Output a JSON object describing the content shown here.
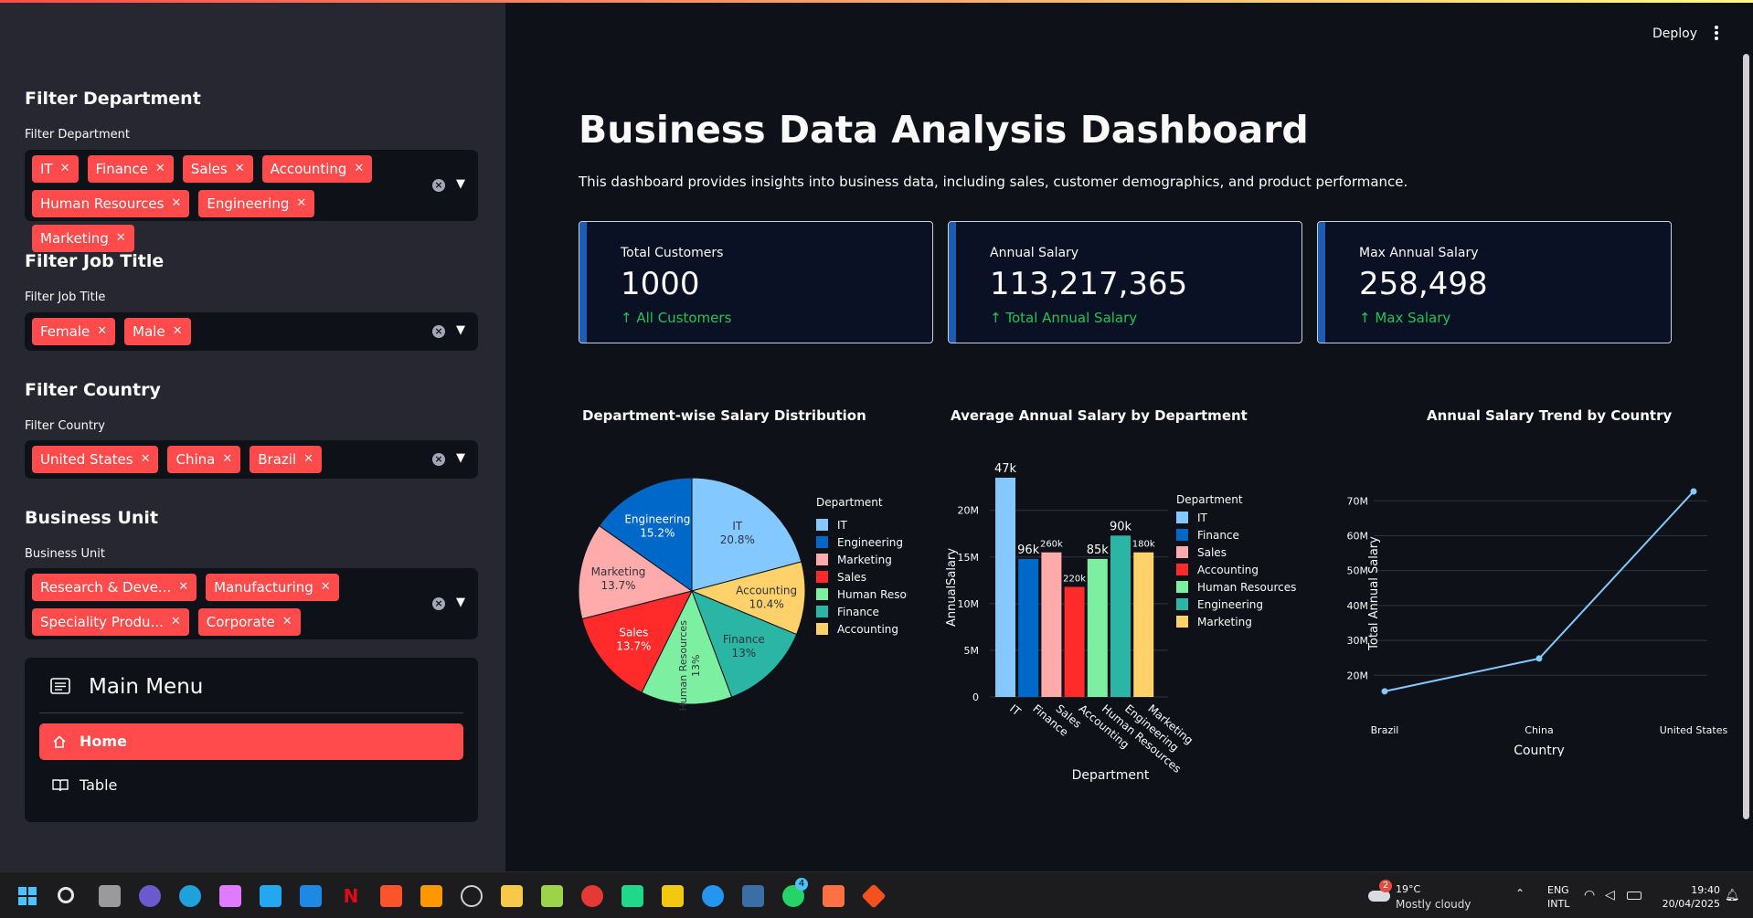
{
  "header": {
    "deploy_label": "Deploy",
    "more_icon": "vertical-ellipsis-icon"
  },
  "sidebar": {
    "department": {
      "heading": "Filter Department",
      "label": "Filter Department",
      "tags": [
        "IT",
        "Finance",
        "Sales",
        "Accounting",
        "Human Resources",
        "Engineering",
        "Marketing"
      ]
    },
    "job_title": {
      "heading": "Filter Job Title",
      "label": "Filter Job Title",
      "tags": [
        "Female",
        "Male"
      ]
    },
    "country": {
      "heading": "Filter Country",
      "label": "Filter Country",
      "tags": [
        "United States",
        "China",
        "Brazil"
      ]
    },
    "business_unit": {
      "heading": "Business Unit",
      "label": "Business Unit",
      "tags": [
        "Research & Deve...",
        "Manufacturing",
        "Speciality Produ...",
        "Corporate"
      ]
    },
    "menu": {
      "title": "Main Menu",
      "items": [
        {
          "label": "Home",
          "icon": "house-icon",
          "active": true
        },
        {
          "label": "Table",
          "icon": "book-icon",
          "active": false
        }
      ]
    }
  },
  "main": {
    "title": "Business Data Analysis Dashboard",
    "description": "This dashboard provides insights into business data, including sales, customer demographics, and product performance.",
    "kpis": [
      {
        "label": "Total Customers",
        "value": "1000",
        "delta": "All Customers"
      },
      {
        "label": "Annual Salary",
        "value": "113,217,365",
        "delta": "Total Annual Salary"
      },
      {
        "label": "Max Annual Salary",
        "value": "258,498",
        "delta": "Max Salary"
      }
    ]
  },
  "chart_data": [
    {
      "type": "pie",
      "title": "Department-wise Salary Distribution",
      "legend_title": "Department",
      "legend_position": "right",
      "slices": [
        {
          "label": "IT",
          "percent": 20.8,
          "color": "#83c9ff"
        },
        {
          "label": "Accounting",
          "percent": 10.4,
          "color": "#ffd16a"
        },
        {
          "label": "Finance",
          "percent": 13,
          "color": "#2bb5a4"
        },
        {
          "label": "Human Resources",
          "percent": 13,
          "color": "#7defa1"
        },
        {
          "label": "Sales",
          "percent": 13.7,
          "color": "#ff2b2b"
        },
        {
          "label": "Marketing",
          "percent": 13.7,
          "color": "#ffabab"
        },
        {
          "label": "Engineering",
          "percent": 15.2,
          "color": "#0068c9"
        }
      ],
      "slice_labels": [
        "IT\n20.8%",
        "Accounting\n10.4%",
        "Finance\n13%",
        "Human Resources\n13%",
        "Sales\n13.7%",
        "Marketing\n13.7%",
        "Engineering\n15.2%"
      ],
      "legend": [
        "IT",
        "Engineering",
        "Marketing",
        "Sales",
        "Human Resources",
        "Finance",
        "Accounting"
      ],
      "legend_colors": [
        "#83c9ff",
        "#0068c9",
        "#ffabab",
        "#ff2b2b",
        "#7defa1",
        "#2bb5a4",
        "#ffd16a"
      ]
    },
    {
      "type": "bar",
      "title": "Average Annual Salary by Department",
      "xlabel": "Department",
      "ylabel": "AnnualSalary",
      "ylim": [
        0,
        23500000
      ],
      "yticks": [
        0,
        5000000,
        10000000,
        15000000,
        20000000
      ],
      "ytick_labels": [
        "0",
        "5M",
        "10M",
        "15M",
        "20M"
      ],
      "categories": [
        "IT",
        "Finance",
        "Sales",
        "Accounting",
        "Human Resources",
        "Engineering",
        "Marketing"
      ],
      "values": [
        23500000,
        14800000,
        15500000,
        11800000,
        14800000,
        17300000,
        15500000
      ],
      "value_labels": [
        "47k",
        "96k",
        "260k",
        "220k",
        "85k",
        "90k",
        "180k"
      ],
      "colors": [
        "#83c9ff",
        "#0068c9",
        "#ffabab",
        "#ff2b2b",
        "#7defa1",
        "#2bb5a4",
        "#ffd16a"
      ],
      "legend_title": "Department",
      "legend": [
        "IT",
        "Finance",
        "Sales",
        "Accounting",
        "Human Resources",
        "Engineering",
        "Marketing"
      ],
      "legend_position": "right"
    },
    {
      "type": "line",
      "title": "Annual Salary Trend by Country",
      "xlabel": "Country",
      "ylabel": "Total Annual Salary",
      "categories": [
        "Brazil",
        "China",
        "United States"
      ],
      "values": [
        15400000,
        24800000,
        72700000
      ],
      "ylim": [
        13000000,
        74000000
      ],
      "yticks": [
        20000000,
        30000000,
        40000000,
        50000000,
        60000000,
        70000000
      ],
      "ytick_labels": [
        "20M",
        "30M",
        "40M",
        "50M",
        "60M",
        "70M"
      ],
      "color": "#83c9ff",
      "grid": true
    }
  ],
  "taskbar": {
    "weather_temp": "19°C",
    "weather_desc": "Mostly cloudy",
    "weather_badge": "2",
    "lang_top": "ENG",
    "lang_bottom": "INTL",
    "time": "19:40",
    "date": "20/04/2025",
    "whatsapp_badge": "4"
  }
}
